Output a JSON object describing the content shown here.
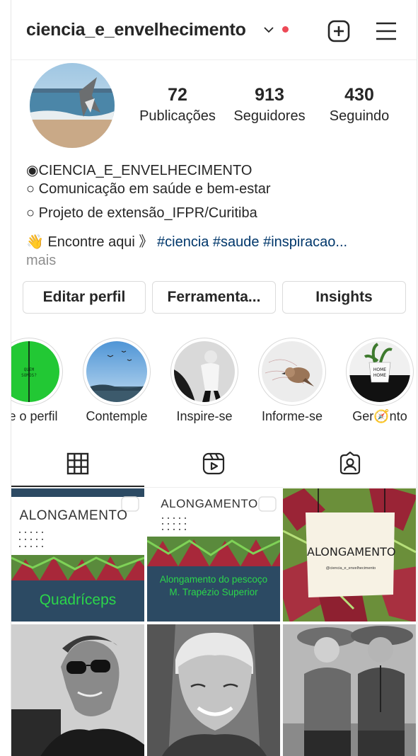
{
  "header": {
    "username": "ciencia_e_envelhecimento"
  },
  "stats": [
    {
      "value": "72",
      "label": "Publicações"
    },
    {
      "value": "913",
      "label": "Seguidores"
    },
    {
      "value": "430",
      "label": "Seguindo"
    }
  ],
  "bio": {
    "name": "◉CIENCIA_E_ENVELHECIMENTO",
    "line1": "○ Comunicação em saúde e bem-estar",
    "line2": "○ Projeto de extensão_IFPR/Curitiba",
    "line3_text": "👋 Encontre aqui 》 ",
    "line3_tags": "#ciencia #saude #inspiracao...",
    "more": "mais"
  },
  "buttons": {
    "edit": "Editar perfil",
    "tools": "Ferramenta...",
    "insights": "Insights"
  },
  "highlights": [
    {
      "label": "re o perfil",
      "cover_text": "QUEM SOMOS?"
    },
    {
      "label": "Contemple"
    },
    {
      "label": "Inspire-se"
    },
    {
      "label": "Informe-se"
    },
    {
      "label": "Ger🧭nto",
      "cover_text": "HOME Sweet HOME"
    }
  ],
  "tabs": [
    "grid-icon",
    "reels-icon",
    "tagged-icon"
  ],
  "posts": [
    {
      "title": "ALONGAMENTO",
      "caption": "Quadríceps"
    },
    {
      "title": "ALONGAMENTO",
      "caption_1": "Alongamento do pescoço",
      "caption_2": "M. Trapézio Superior"
    },
    {
      "title": "ALONGAMENTO",
      "handle": "@ciencia_e_envelhecimento"
    }
  ],
  "colors": {
    "notification": "#ed4956",
    "hashtag": "#00376b",
    "post_navy": "#2c4a63",
    "post_green": "#2bd64a",
    "highlight_green": "#22c834"
  }
}
